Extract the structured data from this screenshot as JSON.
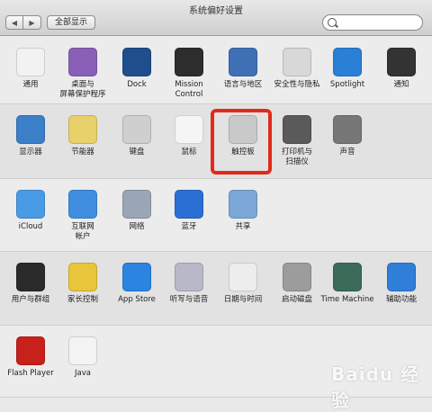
{
  "window": {
    "title": "系统偏好设置"
  },
  "toolbar": {
    "back": "◀",
    "forward": "▶",
    "show_all": "全部显示"
  },
  "search": {
    "value": "",
    "placeholder": ""
  },
  "rows": [
    {
      "items": [
        {
          "label": "通用",
          "icon": "general-icon",
          "color": "#f2f2f2"
        },
        {
          "label": "桌面与\n屏幕保护程序",
          "icon": "desktop-icon",
          "color": "#8a5fb8"
        },
        {
          "label": "Dock",
          "icon": "dock-icon",
          "color": "#1f4e8c"
        },
        {
          "label": "Mission\nControl",
          "icon": "mission-control-icon",
          "color": "#2d2d2d"
        },
        {
          "label": "语言与地区",
          "icon": "language-icon",
          "color": "#3f6fb5"
        },
        {
          "label": "安全性与隐私",
          "icon": "security-icon",
          "color": "#d8d8d8"
        },
        {
          "label": "Spotlight",
          "icon": "spotlight-icon",
          "color": "#2a7fd6"
        },
        {
          "label": "通知",
          "icon": "notifications-icon",
          "color": "#333333"
        }
      ]
    },
    {
      "items": [
        {
          "label": "显示器",
          "icon": "display-icon",
          "color": "#3a7fc8"
        },
        {
          "label": "节能器",
          "icon": "energy-saver-icon",
          "color": "#e8d06a"
        },
        {
          "label": "键盘",
          "icon": "keyboard-icon",
          "color": "#cfcfcf"
        },
        {
          "label": "鼠标",
          "icon": "mouse-icon",
          "color": "#f5f5f5"
        },
        {
          "label": "触控板",
          "icon": "trackpad-icon",
          "color": "#c9c9c9"
        },
        {
          "label": "打印机与\n扫描仪",
          "icon": "printer-icon",
          "color": "#5a5a5a"
        },
        {
          "label": "声音",
          "icon": "sound-icon",
          "color": "#777777"
        }
      ]
    },
    {
      "items": [
        {
          "label": "iCloud",
          "icon": "icloud-icon",
          "color": "#4a9be6"
        },
        {
          "label": "互联网\n帐户",
          "icon": "internet-accounts-icon",
          "color": "#3f8ee0"
        },
        {
          "label": "网络",
          "icon": "network-icon",
          "color": "#9aa6b5"
        },
        {
          "label": "蓝牙",
          "icon": "bluetooth-icon",
          "color": "#2b6fd4"
        },
        {
          "label": "共享",
          "icon": "sharing-icon",
          "color": "#7ba7d6"
        }
      ]
    },
    {
      "items": [
        {
          "label": "用户与群组",
          "icon": "users-icon",
          "color": "#2b2b2b"
        },
        {
          "label": "家长控制",
          "icon": "parental-controls-icon",
          "color": "#e8c53a"
        },
        {
          "label": "App Store",
          "icon": "app-store-icon",
          "color": "#2a84e0"
        },
        {
          "label": "听写与语音",
          "icon": "dictation-icon",
          "color": "#b8b8c8"
        },
        {
          "label": "日期与时间",
          "icon": "date-time-icon",
          "color": "#ededed"
        },
        {
          "label": "启动磁盘",
          "icon": "startup-disk-icon",
          "color": "#9c9c9c"
        },
        {
          "label": "Time Machine",
          "icon": "time-machine-icon",
          "color": "#3d6b5a"
        },
        {
          "label": "辅助功能",
          "icon": "accessibility-icon",
          "color": "#2f7fd9"
        }
      ]
    },
    {
      "items": [
        {
          "label": "Flash Player",
          "icon": "flash-player-icon",
          "color": "#c8201a"
        },
        {
          "label": "Java",
          "icon": "java-icon",
          "color": "#f3f3f3"
        }
      ]
    }
  ],
  "watermark": "Baidu 经验"
}
